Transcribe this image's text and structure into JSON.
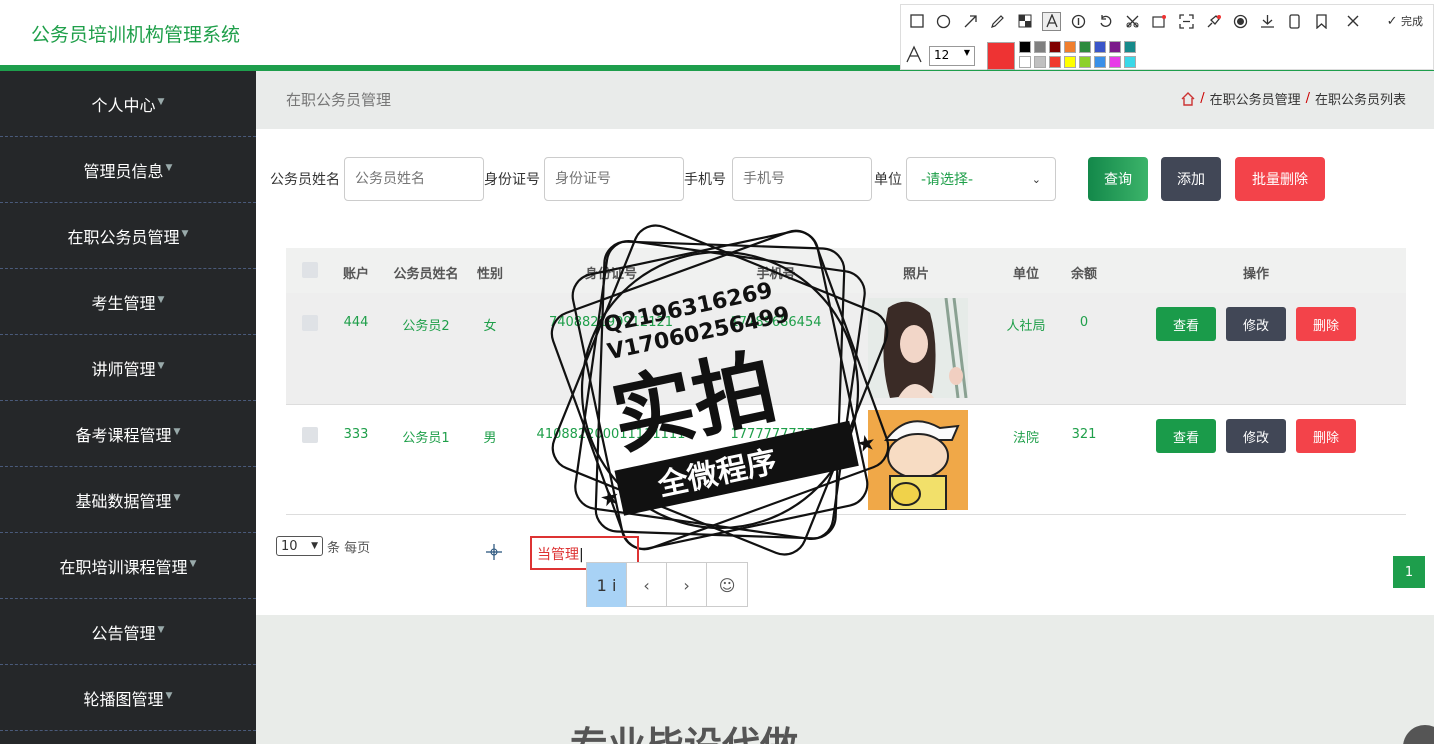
{
  "header": {
    "title": "公务员培训机构管理系统"
  },
  "sidebar": {
    "items": [
      {
        "label": "个人中心"
      },
      {
        "label": "管理员信息"
      },
      {
        "label": "在职公务员管理"
      },
      {
        "label": "考生管理"
      },
      {
        "label": "讲师管理"
      },
      {
        "label": "备考课程管理"
      },
      {
        "label": "基础数据管理"
      },
      {
        "label": "在职培训课程管理"
      },
      {
        "label": "公告管理"
      },
      {
        "label": "轮播图管理"
      }
    ]
  },
  "page": {
    "title": "在职公务员管理",
    "breadcrumb": [
      "在职公务员管理",
      "在职公务员列表"
    ],
    "separator": "/"
  },
  "search": {
    "name_label": "公务员姓名",
    "name_placeholder": "公务员姓名",
    "id_label": "身份证号",
    "id_placeholder": "身份证号",
    "phone_label": "手机号",
    "phone_placeholder": "手机号",
    "unit_label": "单位",
    "unit_value": "-请选择-",
    "query": "查询",
    "add": "添加",
    "batch_delete": "批量删除"
  },
  "table": {
    "headers": [
      "账户",
      "公务员姓名",
      "性别",
      "身份证号",
      "手机号",
      "照片",
      "单位",
      "余额",
      "操作"
    ],
    "rows": [
      {
        "account": "444",
        "name": "公务员2",
        "gender": "女",
        "id": "740882199912121",
        "phone": "17789686454",
        "unit": "人社局",
        "balance": "0"
      },
      {
        "account": "333",
        "name": "公务员1",
        "gender": "男",
        "id": "410882200011111111",
        "phone": "17777777777",
        "unit": "法院",
        "balance": "321"
      }
    ],
    "actions": {
      "view": "查看",
      "edit": "修改",
      "delete": "删除"
    }
  },
  "pager": {
    "page_size": "10",
    "per_page_text": "条 每页",
    "current": "1"
  },
  "lower": {
    "text": "专业毕设代做"
  },
  "screenshot_tool": {
    "font_size": "12",
    "done": "完成",
    "accent": "#ee3333"
  },
  "annotation": {
    "text": "当管理",
    "toolbar_count": "1",
    "toolbar_cursor": "i"
  },
  "watermark": {
    "line1": "Q2196316269",
    "line2": "V17060256499",
    "big": "实拍",
    "banner": "全微程序"
  }
}
